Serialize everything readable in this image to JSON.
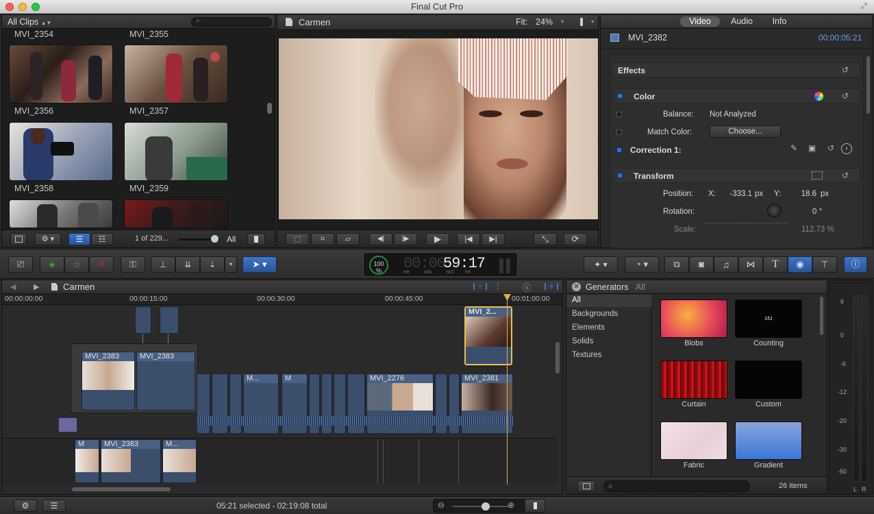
{
  "app": {
    "title": "Final Cut Pro"
  },
  "browser": {
    "library_label": "All Clips",
    "clips_top": [
      "MVI_2354",
      "MVI_2355"
    ],
    "clips": [
      {
        "name": "MVI_2356"
      },
      {
        "name": "MVI_2357"
      },
      {
        "name": "MVI_2358"
      },
      {
        "name": "MVI_2359"
      }
    ],
    "page_count": "1 of 229...",
    "filter_label": "All"
  },
  "viewer": {
    "title": "Carmen",
    "fit_label": "Fit:",
    "zoom": "24%"
  },
  "inspector": {
    "tabs": [
      "Video",
      "Audio",
      "Info"
    ],
    "active_tab": "Video",
    "clip_name": "MVI_2382",
    "timecode": "00:00:05:21",
    "effects_label": "Effects",
    "color_label": "Color",
    "balance_label": "Balance:",
    "balance_value": "Not Analyzed",
    "match_color_label": "Match Color:",
    "choose_button": "Choose...",
    "correction_label": "Correction 1:",
    "transform_label": "Transform",
    "position_label": "Position:",
    "x_label": "X:",
    "x_value": "-333.1",
    "px1": "px",
    "y_label": "Y:",
    "y_value": "18.6",
    "px2": "px",
    "rotation_label": "Rotation:",
    "rotation_value": "0 °",
    "scale_label": "Scale:",
    "scale_value": "112.73 %"
  },
  "dashboard": {
    "percent": "100",
    "percent_unit": "%",
    "time_prefix": "00:00:",
    "time_main": "59:17",
    "labels": [
      "HR",
      "MIN",
      "SEC",
      "FR"
    ]
  },
  "timeline": {
    "project": "Carmen",
    "ruler": [
      "00:00:00:00",
      "00:00:15:00",
      "00:00:30:00",
      "00:00:45:00",
      "00:01:00:00"
    ],
    "clips": {
      "top_clip": "MVI_2...",
      "c2383a": "MVI_2383",
      "c2383b": "MVI_2383",
      "cm1": "M...",
      "cm2": "M",
      "c2276": "MVI_2276",
      "c2381": "MVI_2381",
      "cm3": "M",
      "c2383c": "MVI_2383",
      "cm4": "M..."
    }
  },
  "generators": {
    "title": "Generators",
    "filter": "All",
    "categories": [
      "All",
      "Backgrounds",
      "Elements",
      "Solids",
      "Textures"
    ],
    "items": [
      {
        "name": "Blobs"
      },
      {
        "name": "Counting",
        "text": "151"
      },
      {
        "name": "Curtain"
      },
      {
        "name": "Custom"
      },
      {
        "name": "Fabric"
      },
      {
        "name": "Gradient"
      }
    ],
    "count": "26 items"
  },
  "meters": {
    "scale": [
      "6",
      "0",
      "-6",
      "-12",
      "-20",
      "-30",
      "-50"
    ],
    "channels": [
      "L",
      "R"
    ]
  },
  "statusbar": {
    "selection": "05:21 selected - 02:19:08 total"
  }
}
